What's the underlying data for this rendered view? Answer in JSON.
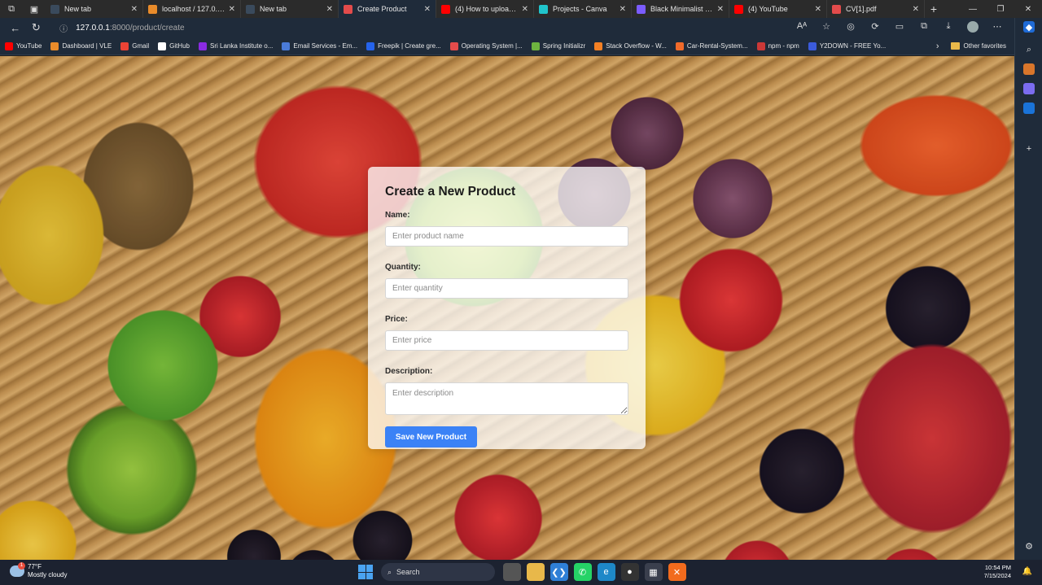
{
  "browser": {
    "tabs": [
      {
        "title": "New tab",
        "color": "#3a4a5c"
      },
      {
        "title": "localhost / 127.0.0.1 /",
        "color": "#e98b2a"
      },
      {
        "title": "New tab",
        "color": "#3a4a5c"
      },
      {
        "title": "Create Product",
        "color": "#e34b4b",
        "active": true
      },
      {
        "title": "(4) How to upload fil",
        "color": "#ff0000"
      },
      {
        "title": "Projects - Canva",
        "color": "#20c4cb"
      },
      {
        "title": "Black Minimalist Stru",
        "color": "#7b5cff"
      },
      {
        "title": "(4) YouTube",
        "color": "#ff0000"
      },
      {
        "title": "CV[1].pdf",
        "color": "#e34b4b"
      }
    ],
    "address": {
      "host": "127.0.0.1",
      "path": ":8000/product/create"
    },
    "bookmarks": [
      {
        "label": "YouTube",
        "color": "#ff0000"
      },
      {
        "label": "Dashboard | VLE",
        "color": "#e98b2a"
      },
      {
        "label": "Gmail",
        "color": "#ea4335"
      },
      {
        "label": "GitHub",
        "color": "#ffffff"
      },
      {
        "label": "Sri Lanka Institute o...",
        "color": "#8a2be2"
      },
      {
        "label": "Email Services - Em...",
        "color": "#4a7bd8"
      },
      {
        "label": "Freepik | Create gre...",
        "color": "#2563eb"
      },
      {
        "label": "Operating System |...",
        "color": "#e34b4b"
      },
      {
        "label": "Spring Initializr",
        "color": "#6db33f"
      },
      {
        "label": "Stack Overflow - W...",
        "color": "#f48024"
      },
      {
        "label": "Car-Rental-System...",
        "color": "#f06a2a"
      },
      {
        "label": "npm - npm",
        "color": "#cb3837"
      },
      {
        "label": "Y2DOWN - FREE Yo...",
        "color": "#3b5bdb"
      }
    ],
    "other_favorites": "Other favorites"
  },
  "form": {
    "title": "Create a New Product",
    "fields": {
      "name": {
        "label": "Name:",
        "placeholder": "Enter product name"
      },
      "quantity": {
        "label": "Quantity:",
        "placeholder": "Enter quantity"
      },
      "price": {
        "label": "Price:",
        "placeholder": "Enter price"
      },
      "description": {
        "label": "Description:",
        "placeholder": "Enter description"
      }
    },
    "submit_label": "Save New Product",
    "accent": "#3b82f6"
  },
  "taskbar": {
    "weather": {
      "temp": "77°F",
      "condition": "Mostly cloudy",
      "badge": "1"
    },
    "search_label": "Search",
    "time": "10:54 PM",
    "date": "7/15/2024"
  }
}
